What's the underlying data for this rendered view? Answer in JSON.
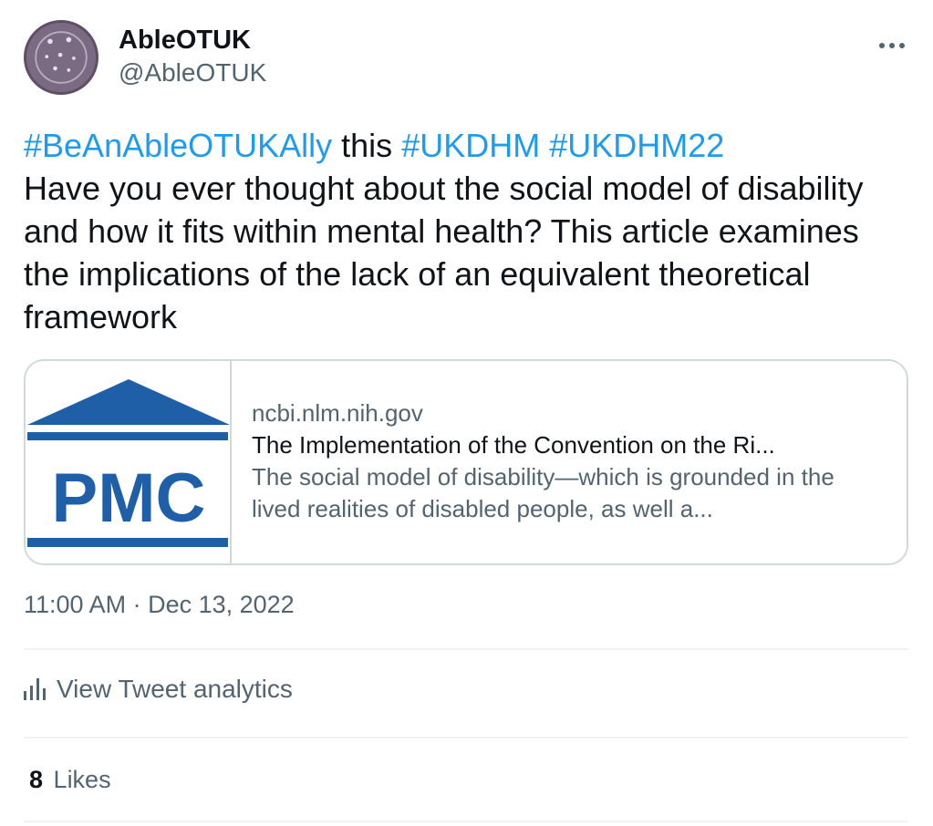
{
  "author": {
    "display_name": "AbleOTUK",
    "handle": "@AbleOTUK",
    "avatar_icon": "logo-avatar"
  },
  "menu": {
    "icon": "more-options-icon"
  },
  "tweet": {
    "hashtag_1": "#BeAnAbleOTUKAlly",
    "connector": " this ",
    "hashtag_2": "#UKDHM",
    "hashtag_3": "#UKDHM22",
    "text": "Have you ever thought about the social model of disability and how it fits within mental health? This article examines the implications of the lack of an equivalent theoretical framework"
  },
  "card": {
    "logo_text": "PMC",
    "domain": "ncbi.nlm.nih.gov",
    "title": "The Implementation of the Convention on the Ri...",
    "description": "The social model of disability—which is grounded in the lived realities of disabled people, as well a..."
  },
  "timestamp": "11:00 AM · Dec 13, 2022",
  "analytics": {
    "label": "View Tweet analytics",
    "icon": "bar-chart-icon"
  },
  "likes": {
    "count": "8",
    "label": "Likes"
  },
  "colors": {
    "link": "#1d9bf0",
    "text": "#0f1419",
    "secondary": "#536471",
    "pmc_blue": "#1f5fa8"
  }
}
